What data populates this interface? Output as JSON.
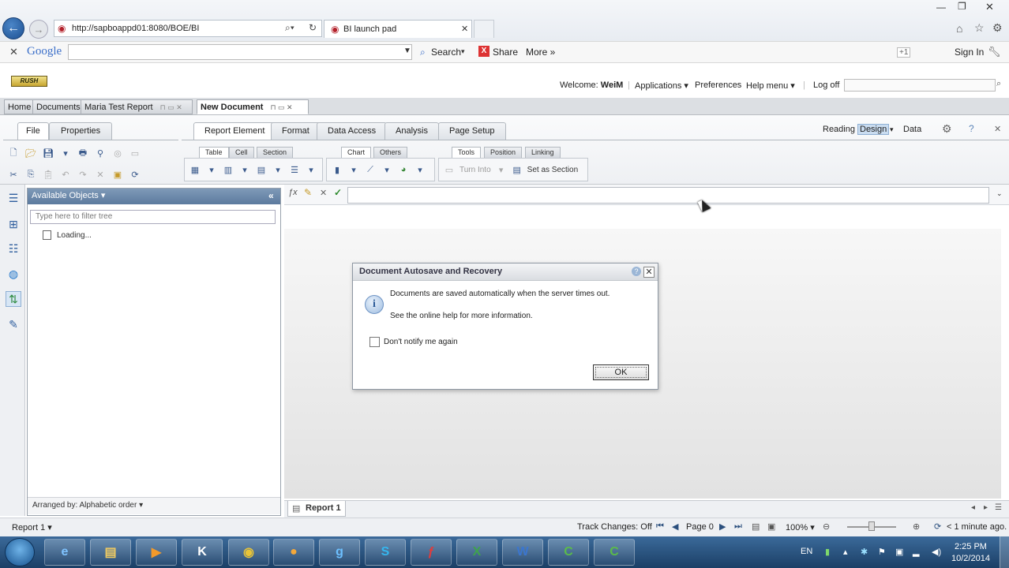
{
  "browser": {
    "url": "http://sapboappd01:8080/BOE/BI",
    "tab_title": "BI launch pad",
    "window_controls": [
      "—",
      "❐",
      "✕"
    ]
  },
  "google_bar": {
    "logo": "Google",
    "search_label": "Search",
    "share_label": "Share",
    "more_label": "More »",
    "signin_label": "Sign In",
    "plus_label": "+1"
  },
  "app_header": {
    "logo_text": "RUSH",
    "welcome_prefix": "Welcome: ",
    "user": "WeiM",
    "applications": "Applications ▾",
    "preferences": "Preferences",
    "help_menu": "Help menu ▾",
    "logoff": "Log off"
  },
  "doc_tabs": {
    "home": "Home",
    "documents": "Documents",
    "maria_report": "Maria Test Report",
    "new_document": "New Document"
  },
  "ribbon": {
    "file": "File",
    "properties": "Properties",
    "tabs": [
      "Report Element",
      "Format",
      "Data Access",
      "Analysis",
      "Page Setup"
    ],
    "views": {
      "reading": "Reading",
      "design": "Design",
      "data": "Data"
    },
    "subtabs": {
      "table": "Table",
      "cell": "Cell",
      "section": "Section",
      "chart": "Chart",
      "others": "Others",
      "tools": "Tools",
      "position": "Position",
      "linking": "Linking"
    },
    "turn_into": "Turn Into",
    "set_as_section": "Set as Section"
  },
  "available_objects": {
    "header": "Available Objects ▾",
    "filter_placeholder": "Type here to filter tree",
    "loading": "Loading...",
    "footer": "Arranged by: Alphabetic order ▾"
  },
  "dialog": {
    "title": "Document Autosave and Recovery",
    "message1": "Documents are saved automatically when the server times out.",
    "message2": "See the online help for more information.",
    "checkbox_label": "Don't notify me again",
    "ok": "OK"
  },
  "report_tab": "Report 1",
  "status_bar": {
    "report_selector": "Report 1 ▾",
    "track_changes": "Track Changes: Off",
    "page": "Page 0",
    "zoom": "100% ▾",
    "refresh": "< 1 minute ago."
  },
  "taskbar": {
    "language": "EN",
    "time": "2:25 PM",
    "date": "10/2/2014",
    "apps": [
      "IE",
      "Files",
      "Media",
      "K",
      "Chrome",
      "Ball",
      "Go",
      "Skype",
      "Flash",
      "Excel",
      "Word",
      "Camtasia",
      "Camtasia2"
    ]
  }
}
